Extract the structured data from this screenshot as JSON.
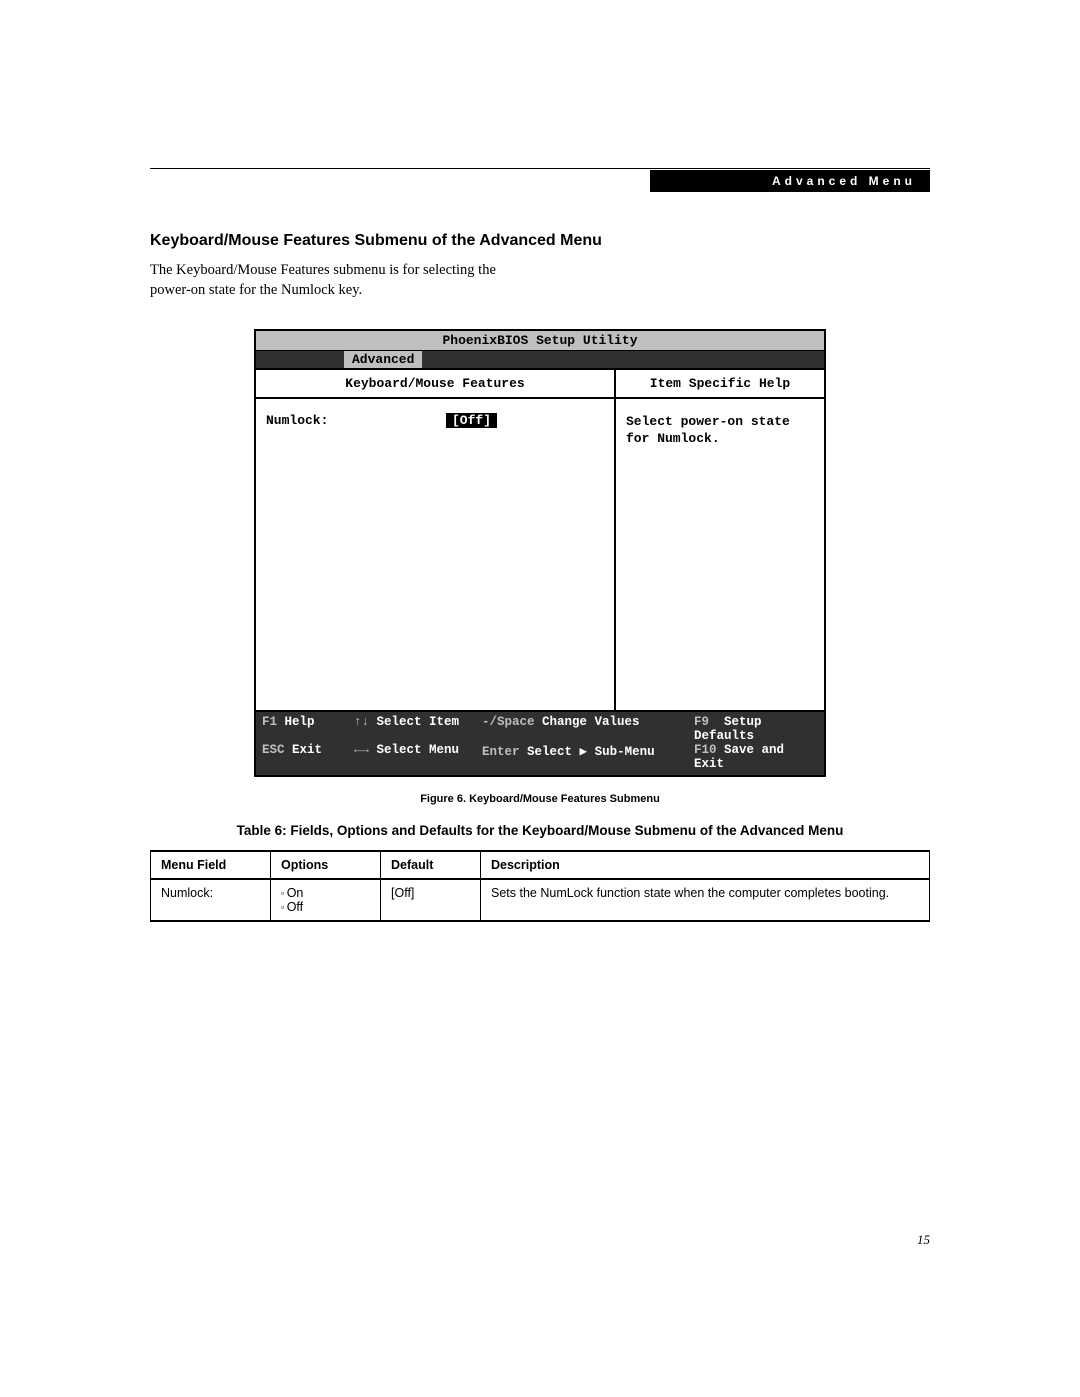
{
  "header": {
    "badge": "Advanced Menu"
  },
  "section": {
    "heading": "Keyboard/Mouse Features Submenu of the Advanced Menu",
    "body": "The Keyboard/Mouse Features submenu is for selecting the power-on state for the Numlock key."
  },
  "bios": {
    "title": "PhoenixBIOS Setup Utility",
    "activeTab": "Advanced",
    "leftHeader": "Keyboard/Mouse Features",
    "rightHeader": "Item Specific Help",
    "field": {
      "label": "Numlock:",
      "value": "[Off]"
    },
    "help": "Select power-on state for Numlock.",
    "footer": {
      "row1": {
        "c1k": "F1",
        "c1t": "Help",
        "c2k": "↑↓",
        "c2t": "Select Item",
        "c3k": "-/Space",
        "c3t": "Change Values",
        "c4k": "F9",
        "c4t": "Setup Defaults"
      },
      "row2": {
        "c1k": "ESC",
        "c1t": "Exit",
        "c2k": "←→",
        "c2t": "Select Menu",
        "c3k": "Enter",
        "c3t": "Select ▶ Sub-Menu",
        "c4k": "F10",
        "c4t": "Save and Exit"
      }
    }
  },
  "figureCaption": "Figure 6.  Keyboard/Mouse Features Submenu",
  "tableCaption": "Table 6: Fields, Options and Defaults for the Keyboard/Mouse Submenu of the Advanced Menu",
  "table": {
    "headers": {
      "c0": "Menu Field",
      "c1": "Options",
      "c2": "Default",
      "c3": "Description"
    },
    "rows": [
      {
        "field": "Numlock:",
        "options": [
          "On",
          "Off"
        ],
        "default": "[Off]",
        "description": "Sets the NumLock function state when the computer completes booting."
      }
    ]
  },
  "pageNumber": "15"
}
